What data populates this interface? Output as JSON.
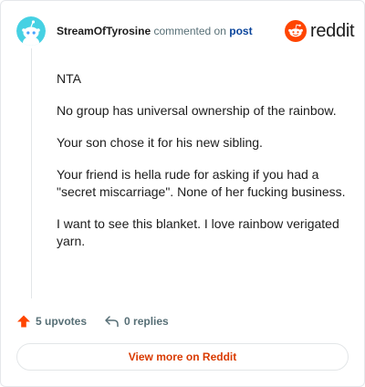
{
  "header": {
    "username": "StreamOfTyrosine",
    "action_text": "commented on",
    "post_link": "post"
  },
  "brand": {
    "name": "reddit",
    "icon": "reddit-snoo-icon",
    "color": "#ff4500"
  },
  "comment": {
    "paragraphs": [
      "NTA",
      "No group has universal ownership of the rainbow.",
      "Your son chose it for his new sibling.",
      "Your friend is hella rude for asking if you had a \"secret miscarriage\". None of her fucking business.",
      "I want to see this blanket. I love rainbow verigated yarn."
    ]
  },
  "actions": {
    "upvotes": "5 upvotes",
    "replies": "0 replies",
    "upvote_icon": "upvote-arrow-icon",
    "reply_icon": "reply-arrow-icon"
  },
  "footer": {
    "view_more_label": "View more on Reddit"
  },
  "colors": {
    "upvote": "#ff4500",
    "link": "#0a449b",
    "view_more": "#d93a00",
    "avatar_bg": "#46d1e3"
  }
}
